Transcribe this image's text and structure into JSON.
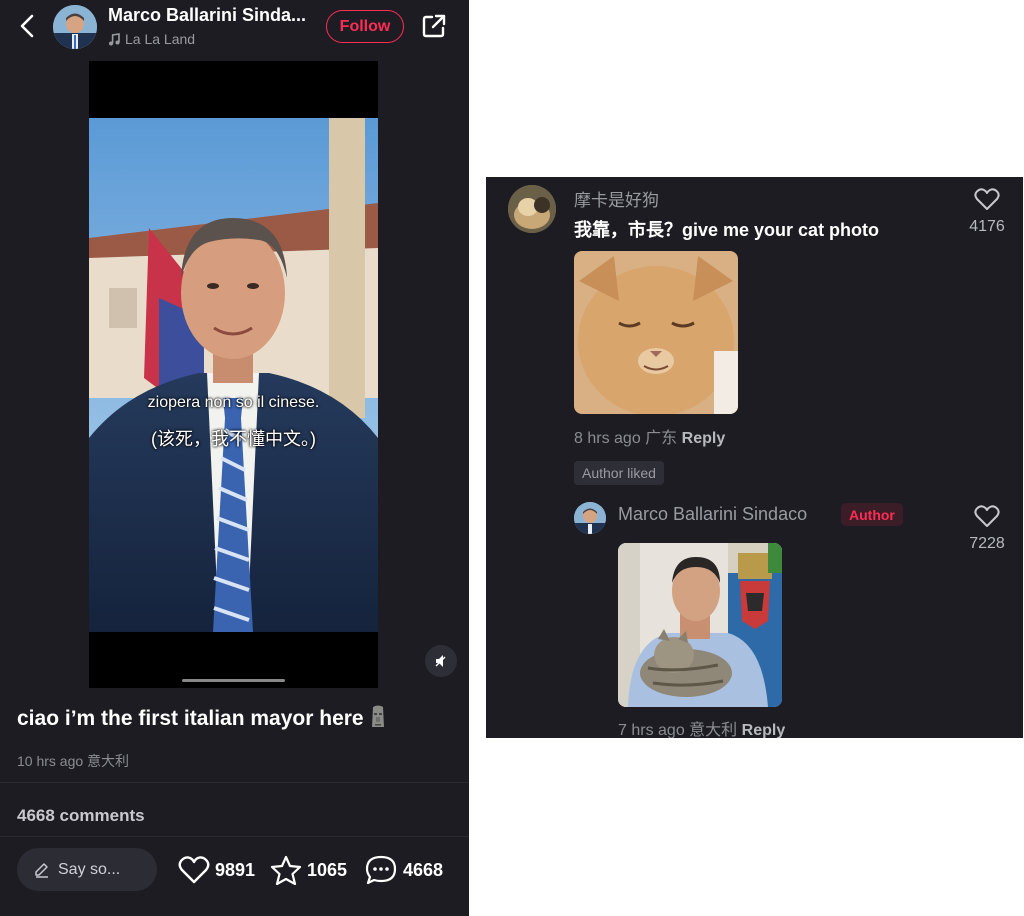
{
  "post": {
    "author": "Marco Ballarini Sinda...",
    "music": "La La Land",
    "follow_label": "Follow",
    "subtitle_it": "ziopera non so il cinese.",
    "subtitle_zh": "(该死，我不懂中文。)",
    "caption": "ciao i’m the first italian mayor here",
    "caption_emoji": "moai-icon",
    "time": "10 hrs ago",
    "location": "意大利",
    "comments_count_label": "4668 comments",
    "input_placeholder": "Say so...",
    "likes": "9891",
    "favorites": "1065",
    "comments": "4668"
  },
  "comment": {
    "user": "摩卡是好狗",
    "text": "我靠，市長？give me your cat photo",
    "time": "8 hrs ago",
    "location": "广东",
    "reply_label": "Reply",
    "likes": "4176",
    "author_liked_label": "Author liked"
  },
  "reply": {
    "user": "Marco Ballarini Sindaco",
    "author_badge": "Author",
    "time": "7 hrs ago",
    "location": "意大利",
    "reply_label": "Reply",
    "likes": "7228"
  },
  "colors": {
    "background": "#1c1c22",
    "accent": "#ff2d55",
    "muted_text": "#8c8c94"
  }
}
